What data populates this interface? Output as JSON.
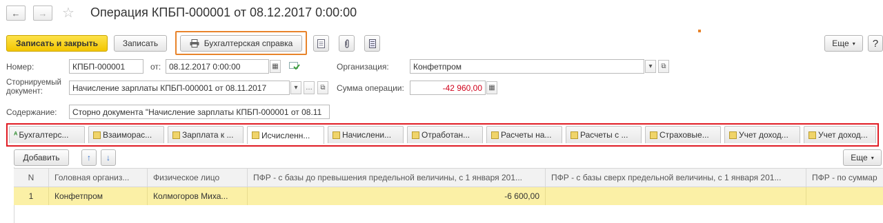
{
  "window": {
    "title": "Операция КПБП-000001 от 08.12.2017 0:00:00",
    "back_glyph": "←",
    "forward_glyph": "→",
    "star_glyph": "☆"
  },
  "toolbar": {
    "save_close_label": "Записать и закрыть",
    "save_label": "Записать",
    "report_label": "Бухгалтерская справка",
    "more_label": "Еще"
  },
  "form": {
    "number_label": "Номер:",
    "number_value": "КПБП-000001",
    "date_label": "от:",
    "date_value": "08.12.2017  0:00:00",
    "org_label": "Организация:",
    "org_value": "Конфетпром",
    "reversed_label_1": "Сторнируемый",
    "reversed_label_2": "документ:",
    "reversed_value": "Начисление зарплаты КПБП-000001 от 08.11.2017",
    "amount_label": "Сумма операции:",
    "amount_value": "-42 960,00",
    "content_label": "Содержание:",
    "content_value": "Сторно документа \"Начисление зарплаты КПБП-000001 от 08.11"
  },
  "tabs": [
    {
      "label": "Бухгалтерс..."
    },
    {
      "label": "Взаиморас..."
    },
    {
      "label": "Зарплата к ..."
    },
    {
      "label": "Исчисленн..."
    },
    {
      "label": "Начислени..."
    },
    {
      "label": "Отработан..."
    },
    {
      "label": "Расчеты на..."
    },
    {
      "label": "Расчеты с ..."
    },
    {
      "label": "Страховые..."
    },
    {
      "label": "Учет доход..."
    },
    {
      "label": "Учет доход..."
    }
  ],
  "table_toolbar": {
    "add_label": "Добавить",
    "up_glyph": "↑",
    "down_glyph": "↓",
    "more_label": "Еще"
  },
  "table": {
    "columns": [
      "N",
      "Головная организ...",
      "Физическое лицо",
      "ПФР - с базы до превышения предельной величины, с 1 января 201...",
      "ПФР - с базы сверх предельной величины, с 1 января 201...",
      "ПФР - по суммар"
    ],
    "rows": [
      [
        "1",
        "Конфетпром",
        "Колмогоров Миха...",
        "-6 600,00",
        "",
        ""
      ]
    ]
  },
  "colors": {
    "accent_yellow": "#f3c600",
    "highlight_orange": "#e8832a",
    "highlight_red": "#e01b23",
    "amount_red": "#d0021b",
    "selected_row": "#fbf0a6"
  }
}
